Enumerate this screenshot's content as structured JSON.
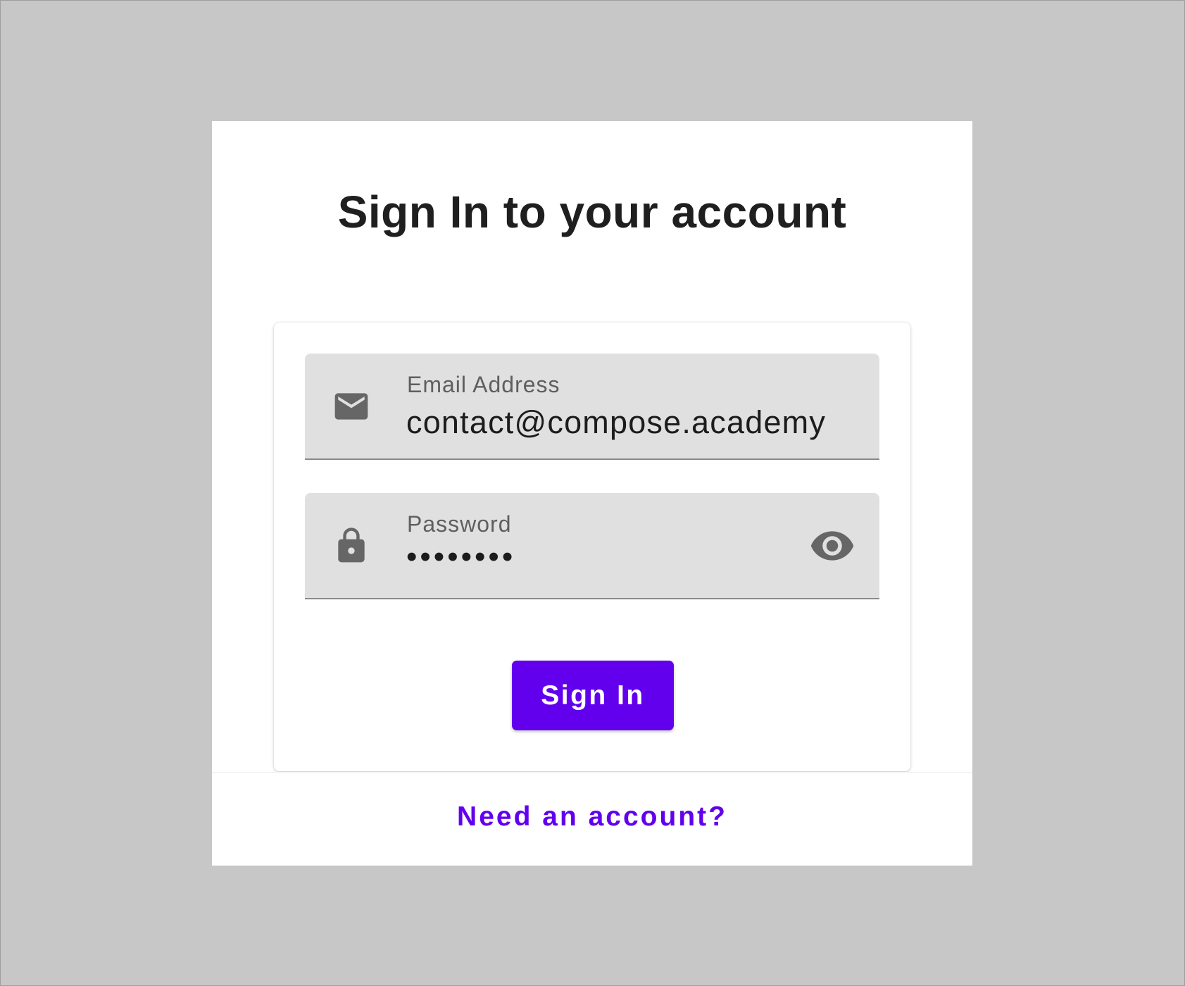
{
  "page": {
    "title": "Sign In to your account"
  },
  "form": {
    "email": {
      "label": "Email Address",
      "value": "contact@compose.academy",
      "icon": "mail-icon"
    },
    "password": {
      "label": "Password",
      "value": "••••••••",
      "icon": "lock-icon",
      "toggle_icon": "eye-icon"
    },
    "submit_label": "Sign In"
  },
  "footer": {
    "link_label": "Need an account?"
  },
  "colors": {
    "background": "#c7c7c7",
    "accent": "#6200ee",
    "field_fill": "#e0e0e0",
    "icon": "#666666"
  }
}
